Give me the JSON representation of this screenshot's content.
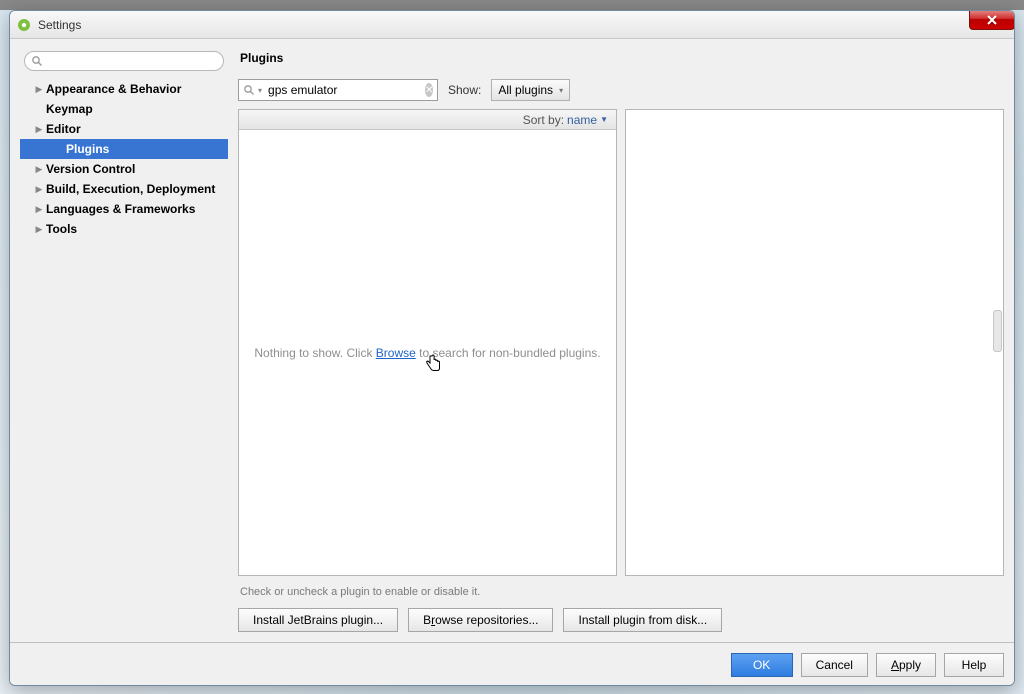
{
  "window": {
    "title": "Settings"
  },
  "sidebar": {
    "search_placeholder": "",
    "items": [
      {
        "label": "Appearance & Behavior",
        "expandable": true
      },
      {
        "label": "Keymap",
        "expandable": false
      },
      {
        "label": "Editor",
        "expandable": true
      },
      {
        "label": "Plugins",
        "expandable": false,
        "child": true,
        "selected": true
      },
      {
        "label": "Version Control",
        "expandable": true
      },
      {
        "label": "Build, Execution, Deployment",
        "expandable": true
      },
      {
        "label": "Languages & Frameworks",
        "expandable": true
      },
      {
        "label": "Tools",
        "expandable": true
      }
    ]
  },
  "main": {
    "header": "Plugins",
    "search_value": "gps emulator",
    "show_label": "Show:",
    "show_value": "All plugins",
    "sortby_prefix": "Sort by:",
    "sortby_value": "name",
    "empty_prefix": "Nothing to show. Click ",
    "empty_link": "Browse",
    "empty_suffix": " to search for non-bundled plugins.",
    "hint": "Check or uncheck a plugin to enable or disable it.",
    "actions": {
      "install_jetbrains": "Install JetBrains plugin...",
      "browse_repos_pre": "B",
      "browse_repos_u": "r",
      "browse_repos_post": "owse repositories...",
      "install_disk": "Install plugin from disk..."
    }
  },
  "footer": {
    "ok": "OK",
    "cancel": "Cancel",
    "apply_pre": "",
    "apply_u": "A",
    "apply_post": "pply",
    "help": "Help"
  }
}
